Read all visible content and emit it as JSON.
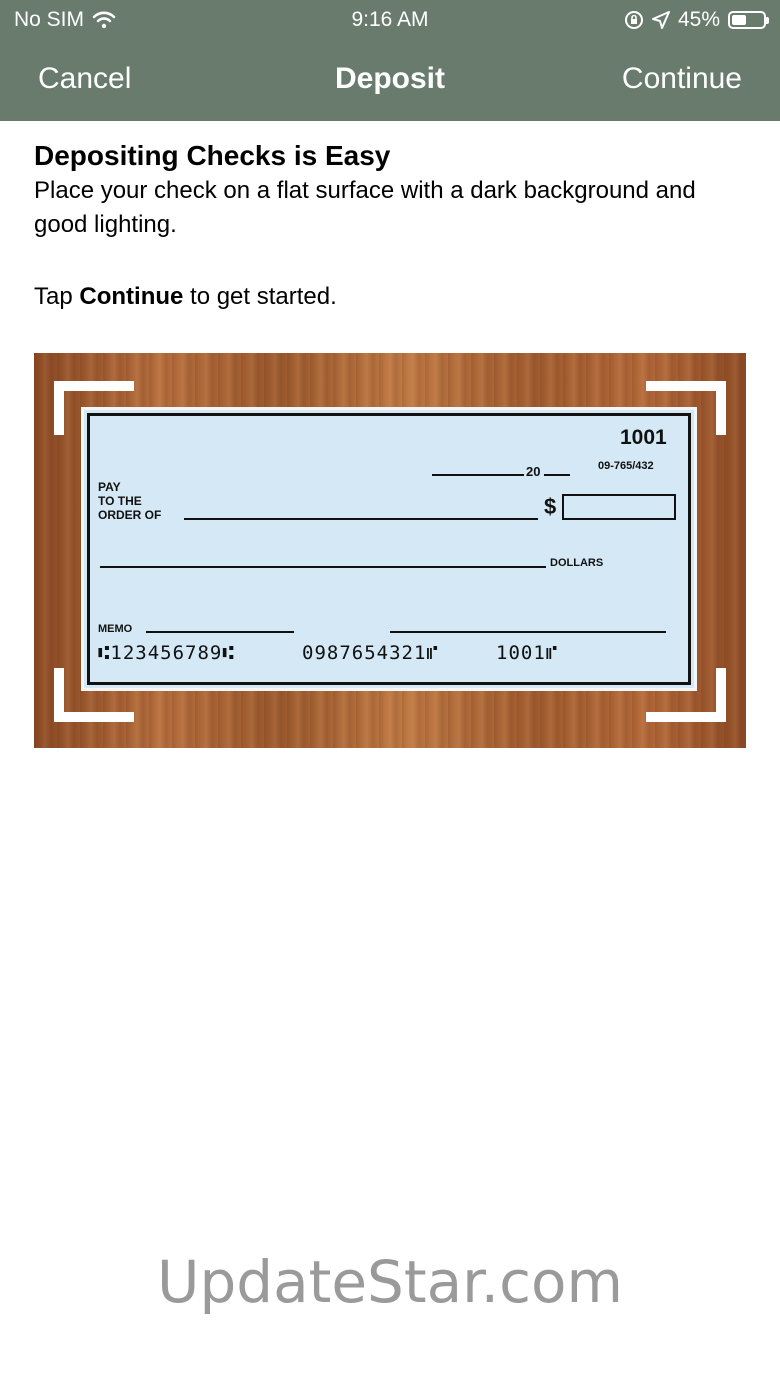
{
  "status_bar": {
    "carrier": "No SIM",
    "time": "9:16 AM",
    "battery_percent": "45%",
    "icons": [
      "wifi-icon",
      "orientation-lock-icon",
      "location-icon",
      "battery-icon"
    ]
  },
  "nav": {
    "cancel_label": "Cancel",
    "title": "Deposit",
    "continue_label": "Continue"
  },
  "intro": {
    "heading": "Depositing Checks is Easy",
    "description": "Place your check on a flat surface with a dark background and good lighting.",
    "tap_prefix": "Tap ",
    "tap_bold": "Continue",
    "tap_suffix": " to get started."
  },
  "check": {
    "number": "1001",
    "date_suffix": "20",
    "routing_fraction": "09-765/432",
    "pay_line1": "PAY",
    "pay_line2": "TO THE",
    "pay_line3": "ORDER OF",
    "dollar_sign": "$",
    "dollars_label": "DOLLARS",
    "memo_label": "MEMO",
    "micr_routing": "⑆123456789⑆",
    "micr_account": "0987654321⑈",
    "micr_check": "1001⑈"
  },
  "watermark": "UpdateStar.com",
  "colors": {
    "header_bg": "#687b6d",
    "check_bg": "#d4e9f5"
  }
}
